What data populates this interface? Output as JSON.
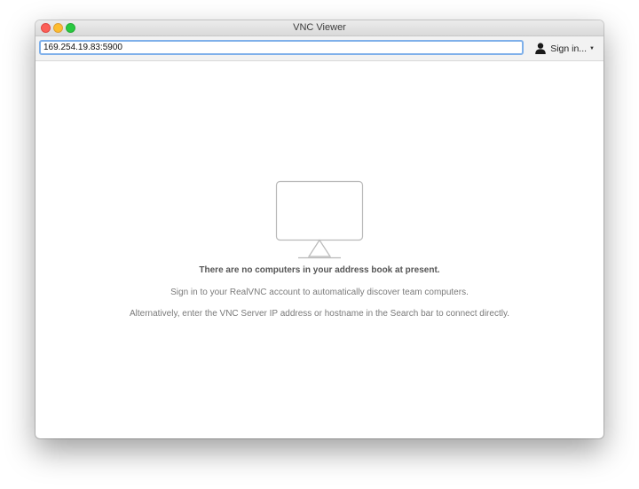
{
  "window": {
    "title": "VNC Viewer"
  },
  "toolbar": {
    "search_value": "169.254.19.83:5900",
    "signin_label": "Sign in...",
    "signin_icon": "person-icon",
    "caret_icon": "caret-down-icon"
  },
  "empty_state": {
    "icon": "monitor-icon",
    "headline": "There are no computers in your address book at present.",
    "line1": "Sign in to your RealVNC account to automatically discover team computers.",
    "line2": "Alternatively, enter the VNC Server IP address or hostname in the Search bar to connect directly."
  },
  "colors": {
    "close": "#fc5f57",
    "minimize": "#fdbc2e",
    "maximize": "#28c940",
    "focus_ring": "#7fb0ea"
  }
}
